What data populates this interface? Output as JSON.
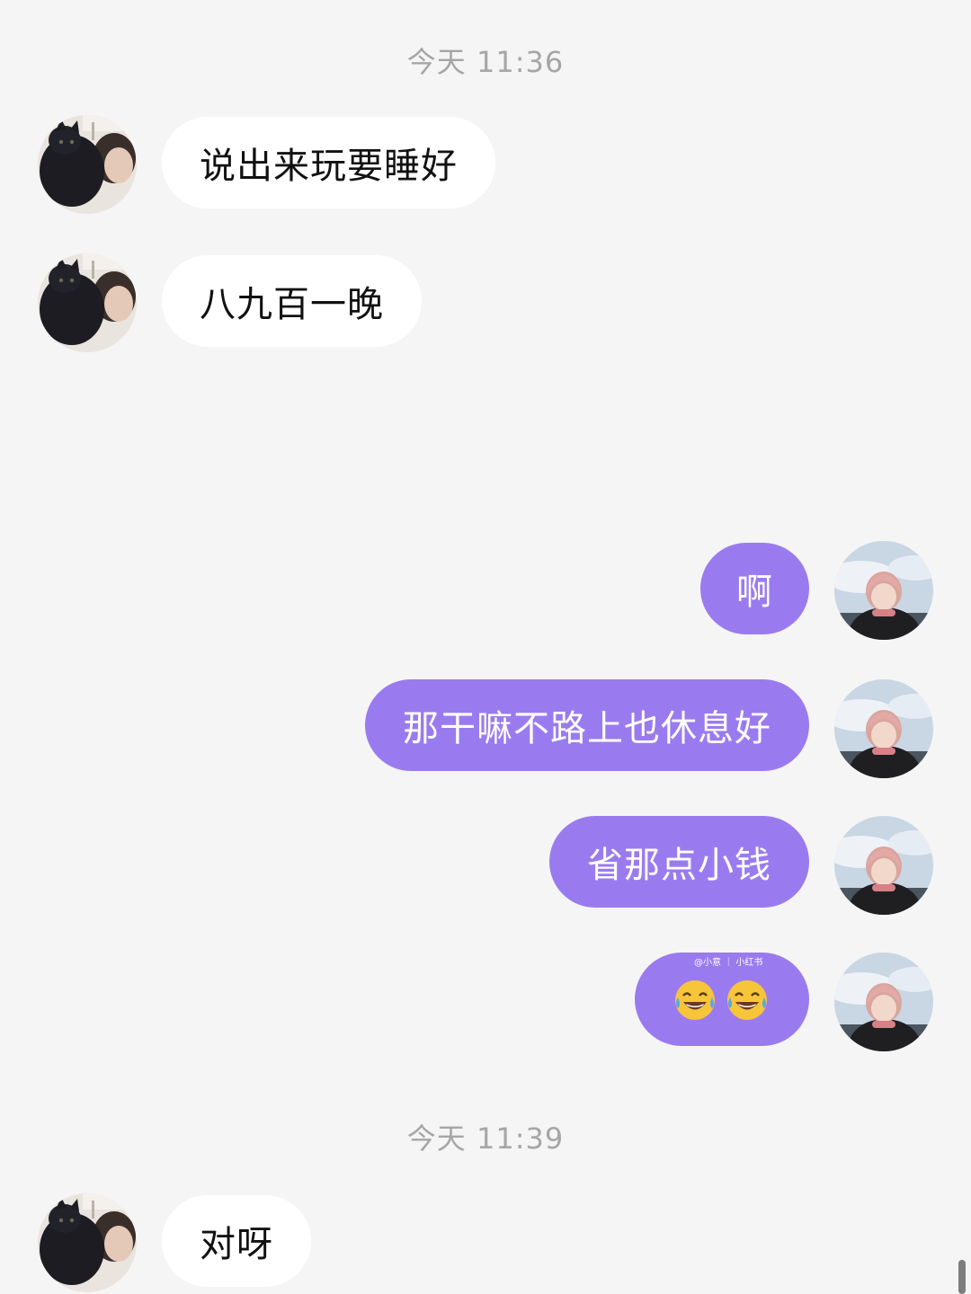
{
  "chat": {
    "timestamps": [
      "今天 11:36",
      "今天 11:39"
    ],
    "messages": [
      {
        "sender": "other",
        "text": "说出来玩要睡好"
      },
      {
        "sender": "other",
        "text": "八九百一晚"
      },
      {
        "sender": "self",
        "text": "啊"
      },
      {
        "sender": "self",
        "text": "那干嘛不路上也休息好"
      },
      {
        "sender": "self",
        "text": "省那点小钱"
      },
      {
        "sender": "self",
        "emoji": "face-with-tears-of-joy x2",
        "watermark": "@小意 ｜ 小红书"
      },
      {
        "sender": "other",
        "text": "对呀"
      }
    ]
  },
  "colors": {
    "background": "#f5f5f5",
    "incoming_bubble": "#ffffff",
    "outgoing_bubble": "#9a7bef",
    "timestamp": "#a6a6a6"
  }
}
